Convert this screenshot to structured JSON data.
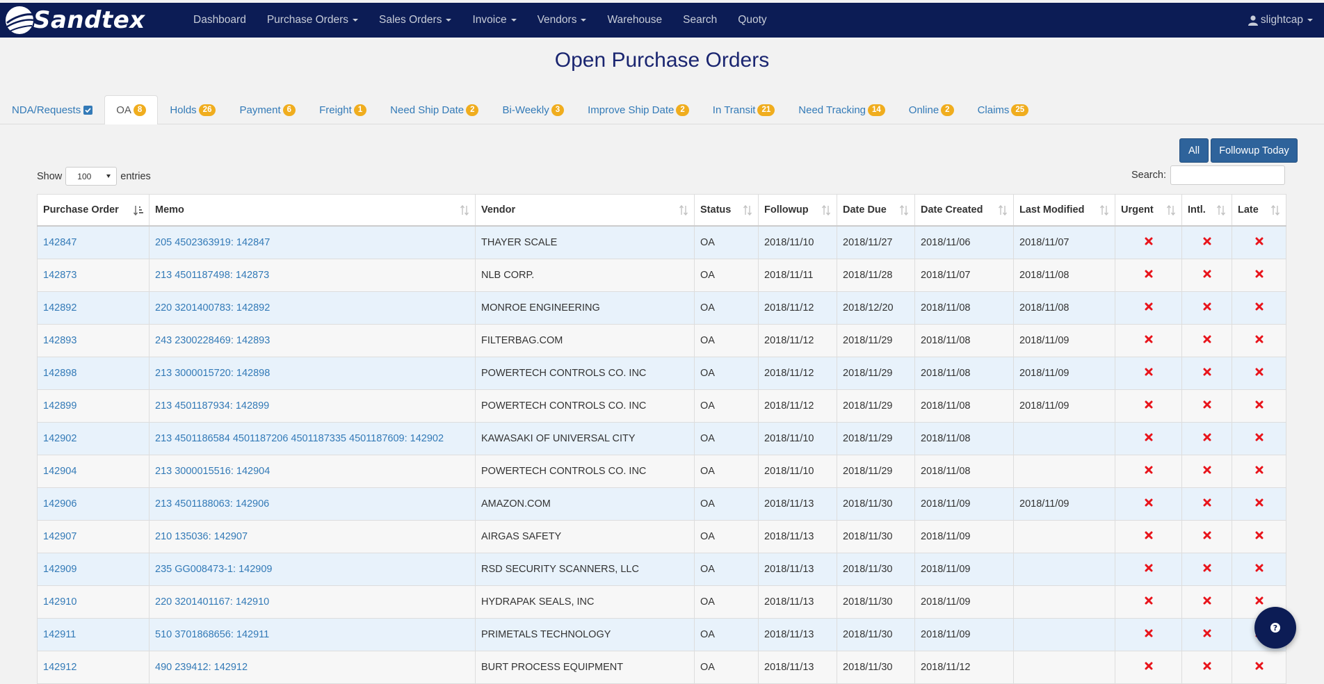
{
  "brand": {
    "name": "Sandtex"
  },
  "nav": {
    "items": [
      {
        "label": "Dashboard",
        "dropdown": false
      },
      {
        "label": "Purchase Orders",
        "dropdown": true
      },
      {
        "label": "Sales Orders",
        "dropdown": true
      },
      {
        "label": "Invoice",
        "dropdown": true
      },
      {
        "label": "Vendors",
        "dropdown": true
      },
      {
        "label": "Warehouse",
        "dropdown": false
      },
      {
        "label": "Search",
        "dropdown": false
      },
      {
        "label": "Quoty",
        "dropdown": false
      }
    ],
    "user": "slightcap"
  },
  "page": {
    "title": "Open Purchase Orders"
  },
  "tabs": [
    {
      "label": "NDA/Requests",
      "badge": "",
      "checkbox": true,
      "active": false
    },
    {
      "label": "OA",
      "badge": "8",
      "active": true
    },
    {
      "label": "Holds",
      "badge": "26",
      "active": false
    },
    {
      "label": "Payment",
      "badge": "6",
      "active": false
    },
    {
      "label": "Freight",
      "badge": "1",
      "active": false
    },
    {
      "label": "Need Ship Date",
      "badge": "2",
      "active": false
    },
    {
      "label": "Bi-Weekly",
      "badge": "3",
      "active": false
    },
    {
      "label": "Improve Ship Date",
      "badge": "2",
      "active": false
    },
    {
      "label": "In Transit",
      "badge": "21",
      "active": false
    },
    {
      "label": "Need Tracking",
      "badge": "14",
      "active": false
    },
    {
      "label": "Online",
      "badge": "2",
      "active": false
    },
    {
      "label": "Claims",
      "badge": "25",
      "active": false
    }
  ],
  "buttons": {
    "all": "All",
    "followup": "Followup Today"
  },
  "controls": {
    "show_label": "Show",
    "entries_value": "100",
    "entries_label": "entries",
    "search_label": "Search:",
    "search_value": ""
  },
  "table": {
    "columns": [
      "Purchase Order",
      "Memo",
      "Vendor",
      "Status",
      "Followup",
      "Date Due",
      "Date Created",
      "Last Modified",
      "Urgent",
      "Intl.",
      "Late"
    ],
    "rows": [
      {
        "po": "142847",
        "memo": "205 4502363919: 142847",
        "vendor": "THAYER SCALE",
        "status": "OA",
        "followup": "2018/11/10",
        "due": "2018/11/27",
        "created": "2018/11/06",
        "modified": "2018/11/07"
      },
      {
        "po": "142873",
        "memo": "213 4501187498: 142873",
        "vendor": "NLB CORP.",
        "status": "OA",
        "followup": "2018/11/11",
        "due": "2018/11/28",
        "created": "2018/11/07",
        "modified": "2018/11/08"
      },
      {
        "po": "142892",
        "memo": "220 3201400783: 142892",
        "vendor": "MONROE ENGINEERING",
        "status": "OA",
        "followup": "2018/11/12",
        "due": "2018/12/20",
        "created": "2018/11/08",
        "modified": "2018/11/08"
      },
      {
        "po": "142893",
        "memo": "243 2300228469: 142893",
        "vendor": "FILTERBAG.COM",
        "status": "OA",
        "followup": "2018/11/12",
        "due": "2018/11/29",
        "created": "2018/11/08",
        "modified": "2018/11/09"
      },
      {
        "po": "142898",
        "memo": "213 3000015720: 142898",
        "vendor": "POWERTECH CONTROLS CO. INC",
        "status": "OA",
        "followup": "2018/11/12",
        "due": "2018/11/29",
        "created": "2018/11/08",
        "modified": "2018/11/09"
      },
      {
        "po": "142899",
        "memo": "213 4501187934: 142899",
        "vendor": "POWERTECH CONTROLS CO. INC",
        "status": "OA",
        "followup": "2018/11/12",
        "due": "2018/11/29",
        "created": "2018/11/08",
        "modified": "2018/11/09"
      },
      {
        "po": "142902",
        "memo": "213 4501186584 4501187206 4501187335 4501187609: 142902",
        "vendor": "KAWASAKI OF UNIVERSAL CITY",
        "status": "OA",
        "followup": "2018/11/10",
        "due": "2018/11/29",
        "created": "2018/11/08",
        "modified": ""
      },
      {
        "po": "142904",
        "memo": "213 3000015516: 142904",
        "vendor": "POWERTECH CONTROLS CO. INC",
        "status": "OA",
        "followup": "2018/11/10",
        "due": "2018/11/29",
        "created": "2018/11/08",
        "modified": ""
      },
      {
        "po": "142906",
        "memo": "213 4501188063: 142906",
        "vendor": "AMAZON.COM",
        "status": "OA",
        "followup": "2018/11/13",
        "due": "2018/11/30",
        "created": "2018/11/09",
        "modified": "2018/11/09"
      },
      {
        "po": "142907",
        "memo": "210 135036: 142907",
        "vendor": "AIRGAS SAFETY",
        "status": "OA",
        "followup": "2018/11/13",
        "due": "2018/11/30",
        "created": "2018/11/09",
        "modified": ""
      },
      {
        "po": "142909",
        "memo": "235 GG008473-1: 142909",
        "vendor": "RSD SECURITY SCANNERS, LLC",
        "status": "OA",
        "followup": "2018/11/13",
        "due": "2018/11/30",
        "created": "2018/11/09",
        "modified": ""
      },
      {
        "po": "142910",
        "memo": "220 3201401167: 142910",
        "vendor": "HYDRAPAK SEALS, INC",
        "status": "OA",
        "followup": "2018/11/13",
        "due": "2018/11/30",
        "created": "2018/11/09",
        "modified": ""
      },
      {
        "po": "142911",
        "memo": "510 3701868656: 142911",
        "vendor": "PRIMETALS TECHNOLOGY",
        "status": "OA",
        "followup": "2018/11/13",
        "due": "2018/11/30",
        "created": "2018/11/09",
        "modified": ""
      },
      {
        "po": "142912",
        "memo": "490 239412: 142912",
        "vendor": "BURT PROCESS EQUIPMENT",
        "status": "OA",
        "followup": "2018/11/13",
        "due": "2018/11/30",
        "created": "2018/11/12",
        "modified": ""
      }
    ]
  },
  "colors": {
    "navbar": "#0c1c55",
    "link": "#337ab7",
    "badge": "#f0ad1e",
    "flag_no": "#e8141b"
  },
  "icons": {
    "user": "user-icon",
    "flag": "x-icon",
    "help": "question-icon",
    "sort": "sort-icon"
  }
}
